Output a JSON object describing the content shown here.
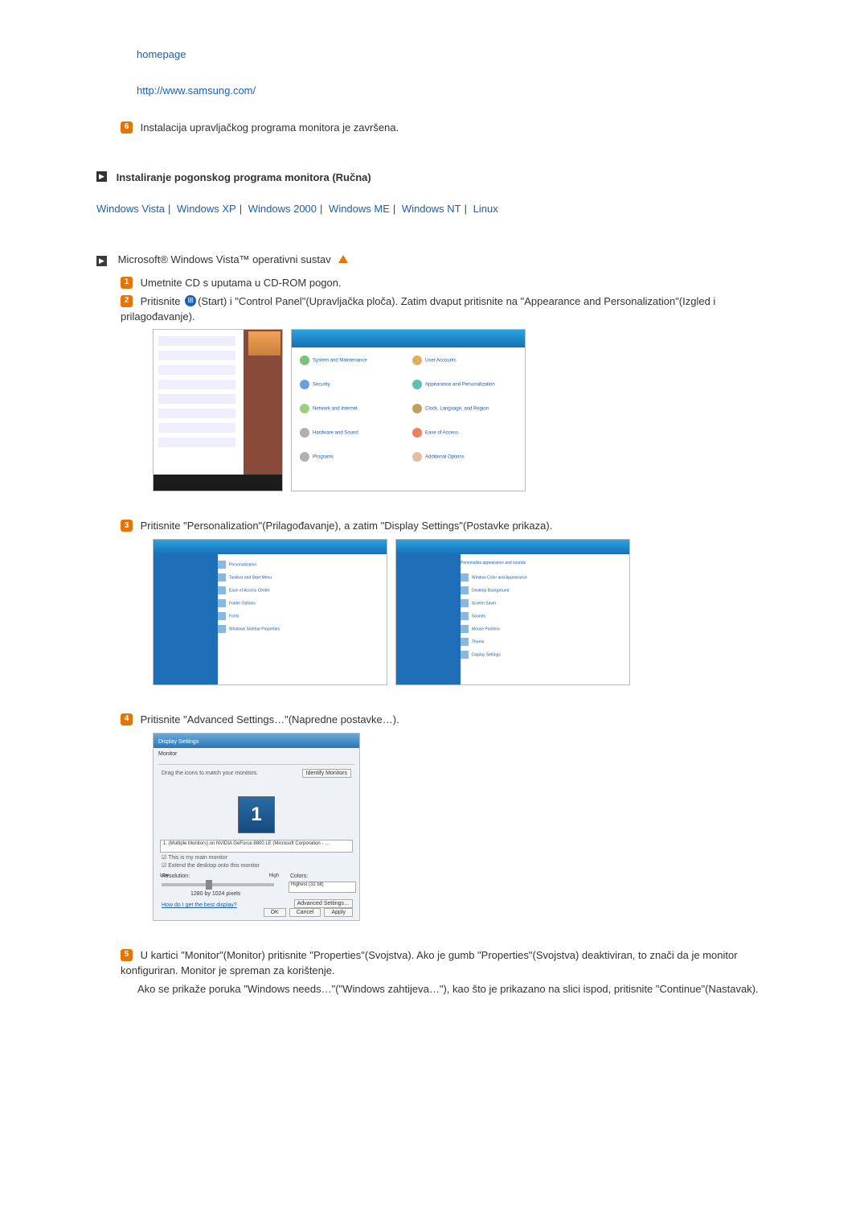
{
  "top": {
    "homepage": "homepage",
    "url": "http://www.samsung.com/"
  },
  "step6": "Instalacija upravljačkog programa monitora je završena.",
  "section_manual": "Instaliranje pogonskog programa monitora (Ručna)",
  "os_links": {
    "vista": "Windows Vista",
    "xp": "Windows XP",
    "w2000": "Windows 2000",
    "me": "Windows ME",
    "nt": "Windows NT",
    "linux": "Linux"
  },
  "vista_heading": "Microsoft® Windows Vista™ operativni sustav",
  "vista_steps": {
    "s1": "Umetnite CD s uputama u CD-ROM pogon.",
    "s2a": "Pritisnite ",
    "s2b": "(Start) i \"Control Panel\"(Upravljačka ploča). Zatim dvaput pritisnite na \"Appearance and Personalization\"(Izgled i prilagođavanje).",
    "s3": "Pritisnite \"Personalization\"(Prilagođavanje), a zatim \"Display Settings\"(Postavke prikaza).",
    "s4": "Pritisnite \"Advanced Settings…\"(Napredne postavke…).",
    "s5": "U kartici \"Monitor\"(Monitor) pritisnite \"Properties\"(Svojstva). Ako je gumb \"Properties\"(Svojstva) deaktiviran, to znači da je monitor konfiguriran. Monitor je spreman za korištenje.",
    "s5b": "Ako se prikaže poruka \"Windows needs…\"(\"Windows zahtijeva…\"), kao što je prikazano na slici ispod, pritisnite \"Continue\"(Nastavak)."
  },
  "display_dialog": {
    "title": "Display Settings",
    "tab": "Monitor",
    "drag": "Drag the icons to match your monitors.",
    "identify": "Identify Monitors",
    "big": "1",
    "dropdown": "1. (Multiple Monitors) on NVIDIA GeForce 8800 LE (Microsoft Corporation - …",
    "chk_main": "This is my main monitor",
    "chk_extend": "Extend the desktop onto this monitor",
    "resolution_label": "Resolution:",
    "low": "Low",
    "high": "High",
    "res_value": "1280 by 1024 pixels",
    "colors_label": "Colors:",
    "colors_value": "Highest (32 bit)",
    "how": "How do I get the best display?",
    "advanced": "Advanced Settings…",
    "ok": "OK",
    "cancel": "Cancel",
    "apply": "Apply"
  }
}
